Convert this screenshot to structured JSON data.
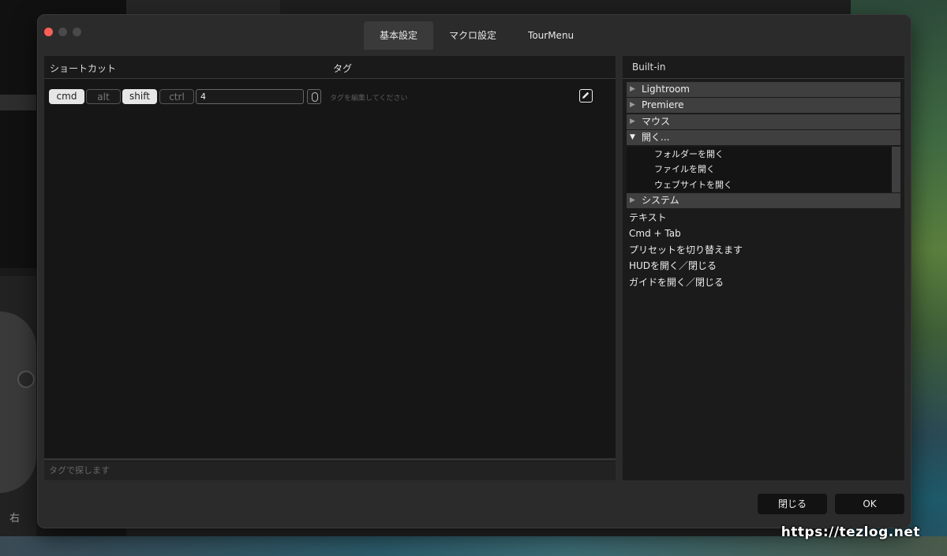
{
  "tabs": [
    "基本設定",
    "マクロ設定",
    "TourMenu"
  ],
  "left": {
    "col_shortcut": "ショートカット",
    "col_tag": "タグ",
    "modifiers": [
      {
        "label": "cmd",
        "active": true
      },
      {
        "label": "alt",
        "active": false
      },
      {
        "label": "shift",
        "active": true
      },
      {
        "label": "ctrl",
        "active": false
      }
    ],
    "key_value": "4",
    "tag_placeholder": "タグを編集してください",
    "search_placeholder": "タグで探します"
  },
  "right": {
    "header": "Built-in",
    "groups_top": [
      "Lightroom",
      "Premiere",
      "マウス"
    ],
    "open_group": "開く...",
    "open_children": [
      "フォルダーを開く",
      "ファイルを開く",
      "ウェブサイトを開く"
    ],
    "group_after": "システム",
    "plain_items": [
      "テキスト",
      "Cmd + Tab",
      "プリセットを切り替えます",
      "HUDを開く／閉じる",
      "ガイドを開く／閉じる"
    ]
  },
  "buttons": {
    "close": "閉じる",
    "ok": "OK"
  },
  "background": {
    "side_label": "右"
  },
  "watermark": "https://tezlog.net",
  "colors": {
    "close_dot": "#ff5f57",
    "active_modifier": "#e6e6e6",
    "pane_bg": "#161616"
  }
}
